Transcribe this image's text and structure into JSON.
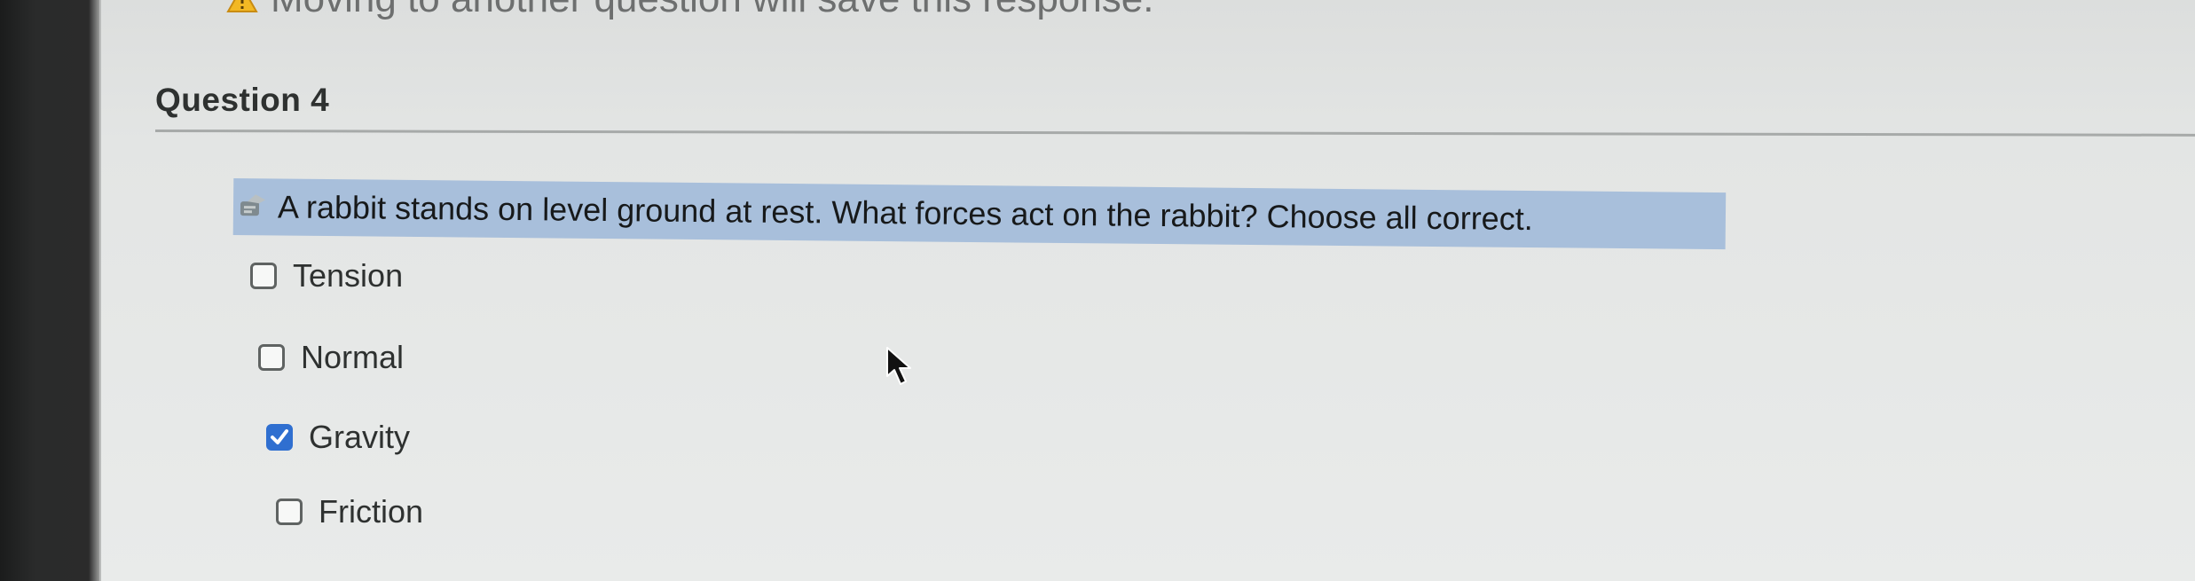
{
  "warning": {
    "text": "Moving to another question will save this response.",
    "icon": "warning-icon"
  },
  "question": {
    "title": "Question 4",
    "prompt": "A rabbit stands on level ground at rest.  What forces act on the rabbit?  Choose all correct.",
    "prompt_icon": "question-icon"
  },
  "options": [
    {
      "label": "Tension",
      "checked": false
    },
    {
      "label": "Normal",
      "checked": false
    },
    {
      "label": "Gravity",
      "checked": true
    },
    {
      "label": "Friction",
      "checked": false
    }
  ],
  "colors": {
    "selection_highlight": "#a8bfdb",
    "checkbox_checked": "#2f6fd0",
    "warning": "#f2b824"
  }
}
